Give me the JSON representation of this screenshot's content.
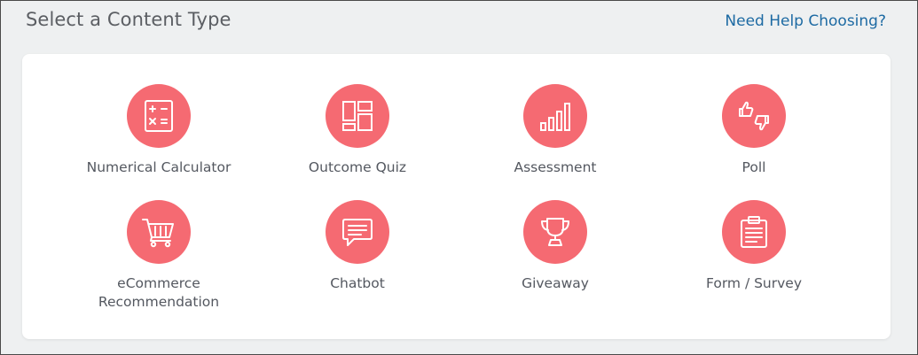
{
  "header": {
    "title": "Select a Content Type",
    "help_link": "Need Help Choosing?"
  },
  "colors": {
    "accent": "#f56a72",
    "link": "#1d6aa3",
    "background": "#eef0f1",
    "card": "#ffffff"
  },
  "content_types": [
    {
      "label": "Numerical Calculator",
      "icon": "calculator-icon"
    },
    {
      "label": "Outcome Quiz",
      "icon": "grid-layout-icon"
    },
    {
      "label": "Assessment",
      "icon": "bar-chart-icon"
    },
    {
      "label": "Poll",
      "icon": "thumbs-up-down-icon"
    },
    {
      "label": "eCommerce Recommendation",
      "icon": "shopping-cart-icon"
    },
    {
      "label": "Chatbot",
      "icon": "chat-bubble-icon"
    },
    {
      "label": "Giveaway",
      "icon": "trophy-icon"
    },
    {
      "label": "Form / Survey",
      "icon": "clipboard-icon"
    }
  ]
}
